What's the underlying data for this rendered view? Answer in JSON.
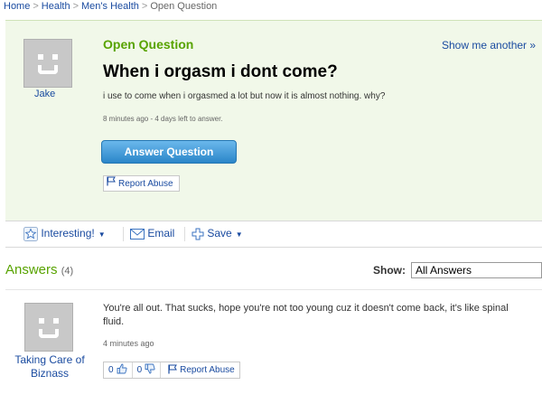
{
  "breadcrumb": {
    "items": [
      "Home",
      "Health",
      "Men's Health"
    ],
    "current": "Open Question",
    "separator": ">"
  },
  "question": {
    "label": "Open Question",
    "show_another": "Show me another »",
    "asker": "Jake",
    "title": "When i orgasm i dont come?",
    "body": "i use to come when i orgasmed a lot but now it is almost nothing. why?",
    "meta": "8 minutes ago - 4 days left to answer.",
    "answer_button": "Answer Question",
    "report_abuse": "Report Abuse"
  },
  "actions": {
    "interesting": "Interesting!",
    "email": "Email",
    "save": "Save"
  },
  "answers": {
    "heading": "Answers",
    "count": "(4)",
    "show_label": "Show:",
    "show_value": "All Answers",
    "items": [
      {
        "author": "Taking Care of Biznass",
        "text": "You're all out. That sucks, hope you're not too young cuz it doesn't come back, it's like spinal fluid.",
        "meta": "4 minutes ago",
        "thumbs_up": "0",
        "thumbs_down": "0",
        "report_abuse": "Report Abuse"
      }
    ]
  },
  "colors": {
    "link": "#1a4ba0",
    "green": "#58a300",
    "question_bg": "#f1f8e9",
    "button_blue": "#2b86c9"
  }
}
